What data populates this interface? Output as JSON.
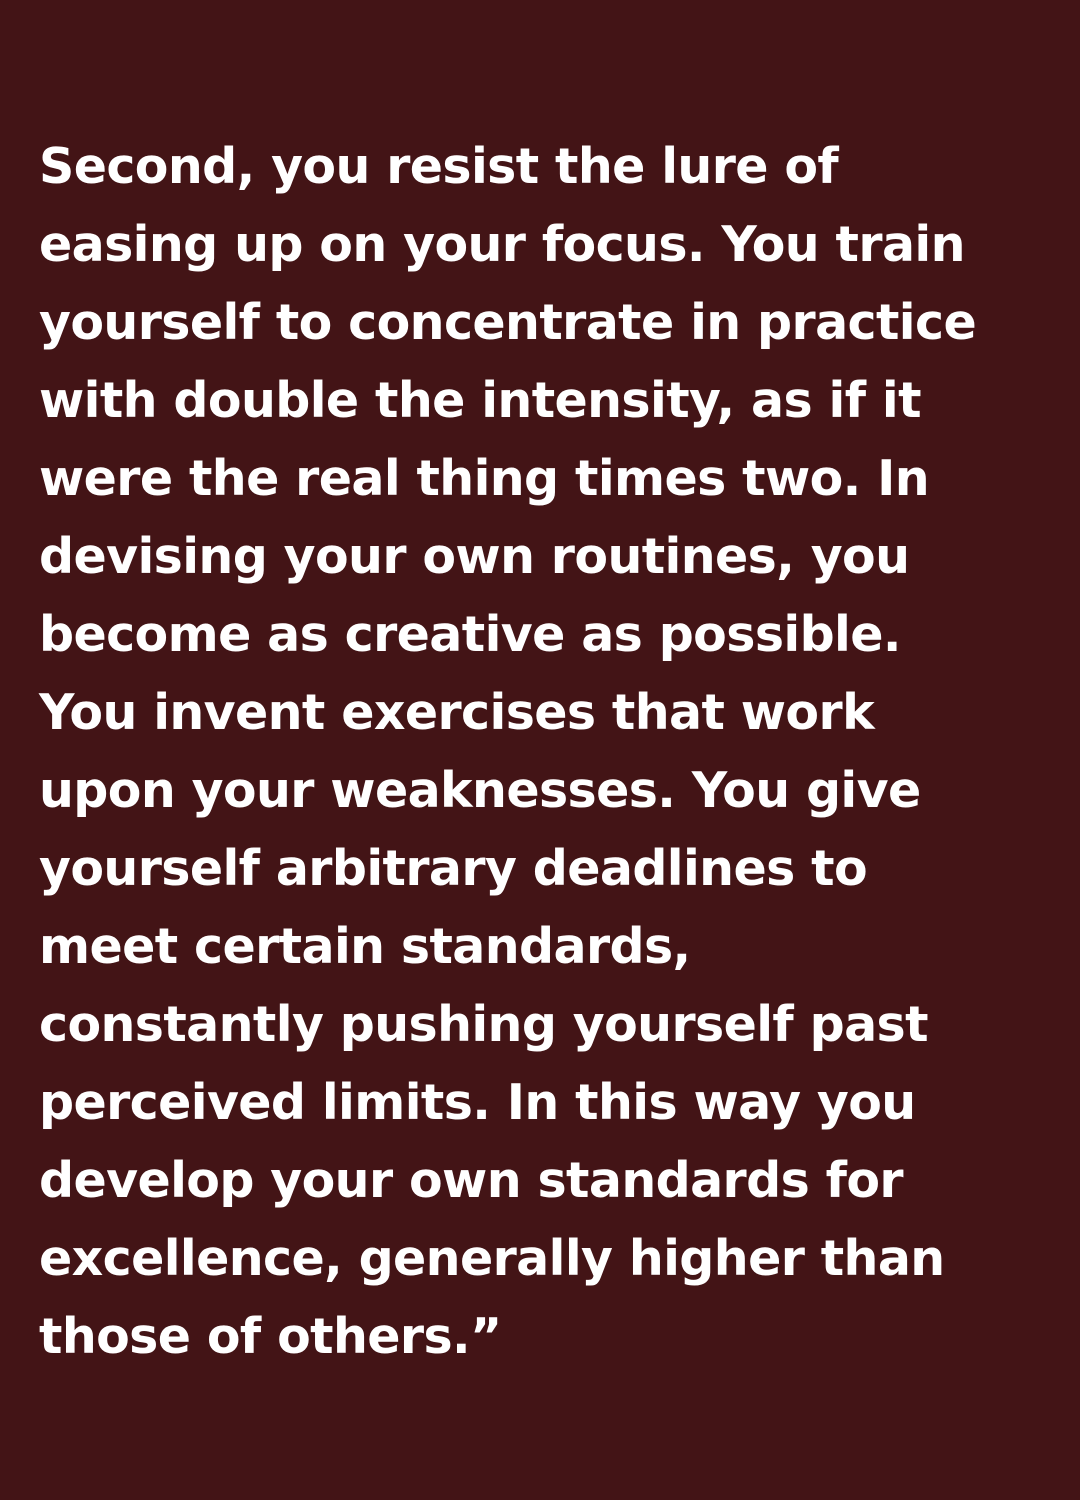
{
  "colors": {
    "background": "#431416",
    "text": "#ffffff"
  },
  "quote": {
    "lines": [
      "Second, you resist the lure of",
      "easing up on your focus. You train",
      "yourself to concentrate in practice",
      "with double the intensity, as if it",
      "were the real thing times two. In",
      "devising your own routines, you",
      "become as creative as possible.",
      "You invent exercises that work",
      "upon your weaknesses. You give",
      "yourself arbitrary deadlines to",
      "meet certain standards,",
      "constantly pushing yourself past",
      "perceived limits. In this way you",
      "develop your own standards for",
      "excellence, generally higher than",
      "those of others.”"
    ]
  }
}
